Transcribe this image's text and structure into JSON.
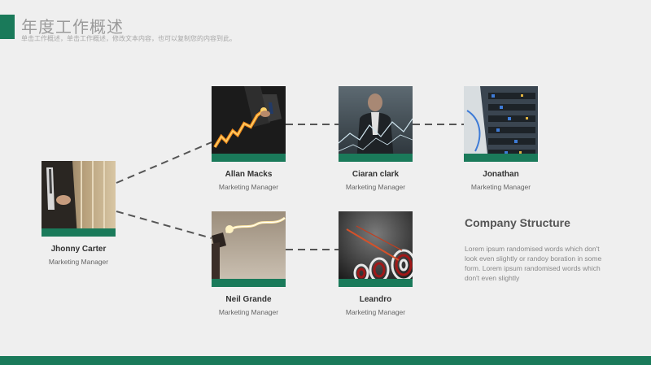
{
  "header": {
    "title": "年度工作概述",
    "subtitle": "单击工作概述，单击工作概述，修改文本内容，也可以复制您的内容到此。"
  },
  "people": [
    {
      "name": "Jhonny Carter",
      "role": "Marketing  Manager",
      "image": "businessman-adjusting-cuff"
    },
    {
      "name": "Allan Macks",
      "role": "Marketing  Manager",
      "image": "businessman-glowing-growth-graph"
    },
    {
      "name": "Neil Grande",
      "role": "Marketing  Manager",
      "image": "hand-holding-sparkler-light"
    },
    {
      "name": "Ciaran clark",
      "role": "Marketing  Manager",
      "image": "thinking-businessman-chart-lines"
    },
    {
      "name": "Leandro",
      "role": "Marketing  Manager",
      "image": "darts-hitting-targets"
    },
    {
      "name": "Jonathan",
      "role": "Marketing  Manager",
      "image": "server-rack-network-cables"
    }
  ],
  "structure": {
    "heading": "Company  Structure",
    "body": "Lorem ipsum randomised words which don't look even slightly or randoy boration in some form. Lorem ipsum randomised words which don't even slightly"
  },
  "colors": {
    "accent": "#1a7a5a",
    "background": "#efefef"
  }
}
